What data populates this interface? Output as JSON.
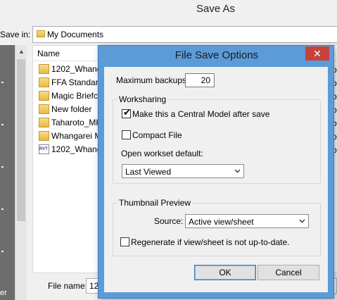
{
  "saveas": {
    "title": "Save As",
    "save_in_label": "Save in:",
    "save_in_value": "My Documents",
    "column_name": "Name",
    "files": [
      {
        "name": "1202_Whang",
        "type": "folder"
      },
      {
        "name": "FFA Standard",
        "type": "folder"
      },
      {
        "name": "Magic Briefca",
        "type": "folder"
      },
      {
        "name": "New folder",
        "type": "folder"
      },
      {
        "name": "Taharoto_MK",
        "type": "folder"
      },
      {
        "name": "Whangarei M",
        "type": "folder"
      },
      {
        "name": "1202_Whang",
        "type": "rvt"
      }
    ],
    "right_col_fragment": "ol",
    "file_name_label": "File name:",
    "file_name_value": "12",
    "left_pane_fragment": "er"
  },
  "dialog": {
    "title": "File Save Options",
    "close_symbol": "✕",
    "max_backups_label": "Maximum backups:",
    "max_backups_value": "20",
    "worksharing": {
      "group_label": "Worksharing",
      "central_model_label": "Make this a Central Model after save",
      "central_model_checked": true,
      "compact_file_label": "Compact File",
      "compact_file_checked": false,
      "open_workset_label": "Open workset default:",
      "open_workset_value": "Last Viewed"
    },
    "thumbnail": {
      "group_label": "Thumbnail Preview",
      "source_label": "Source:",
      "source_value": "Active view/sheet",
      "regenerate_label": "Regenerate if view/sheet is not up-to-date.",
      "regenerate_checked": false
    },
    "ok_label": "OK",
    "cancel_label": "Cancel"
  },
  "colors": {
    "dialog_frame": "#5b9bd8",
    "close_button": "#c7423c",
    "left_pane": "#6d6d6d"
  }
}
